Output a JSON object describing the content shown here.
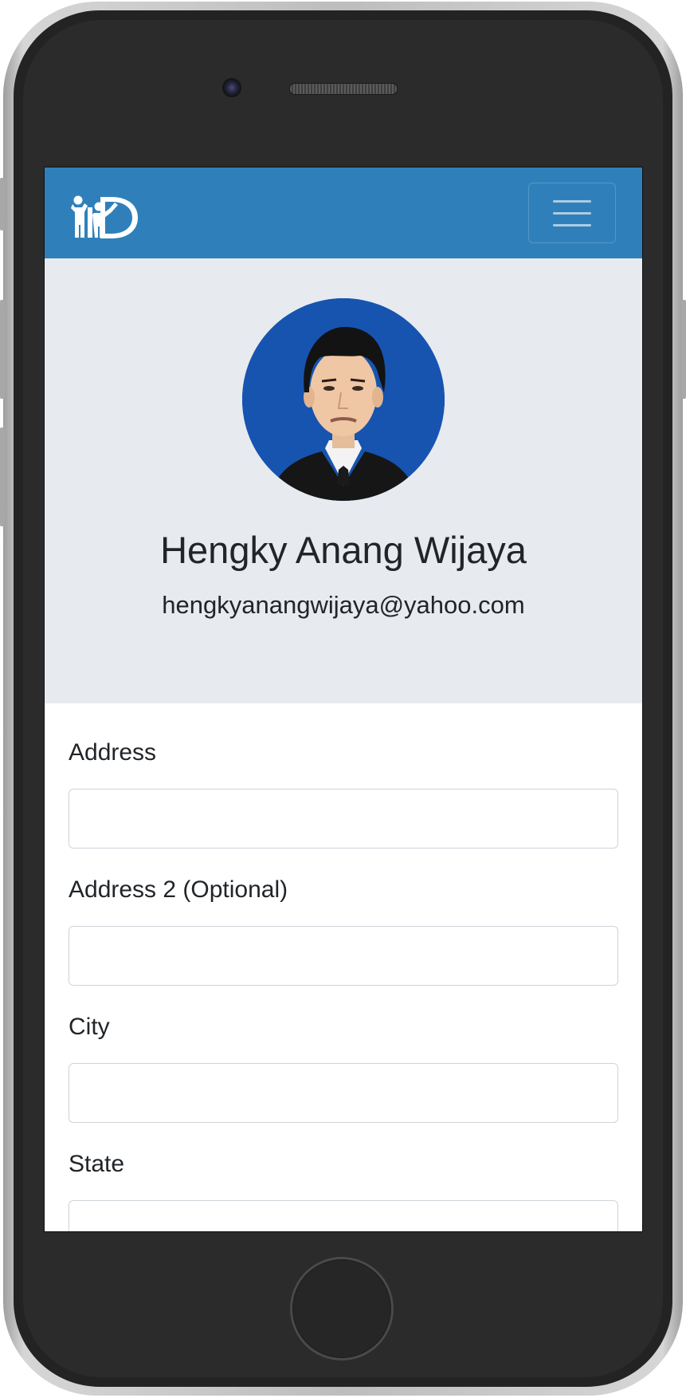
{
  "profile": {
    "name": "Hengky Anang Wijaya",
    "email": "hengkyanangwijaya@yahoo.com"
  },
  "form": {
    "address_label": "Address",
    "address_value": "",
    "address2_label": "Address 2 (Optional)",
    "address2_value": "",
    "city_label": "City",
    "city_value": "",
    "state_label": "State",
    "state_value": ""
  },
  "icons": {
    "brand": "logo-icon",
    "menu": "hamburger-menu-icon"
  },
  "colors": {
    "navbar": "#2f80ba",
    "hero_background": "#e7eaef",
    "avatar_background": "#1654b0",
    "text": "#212529",
    "input_border": "#ced4da"
  }
}
